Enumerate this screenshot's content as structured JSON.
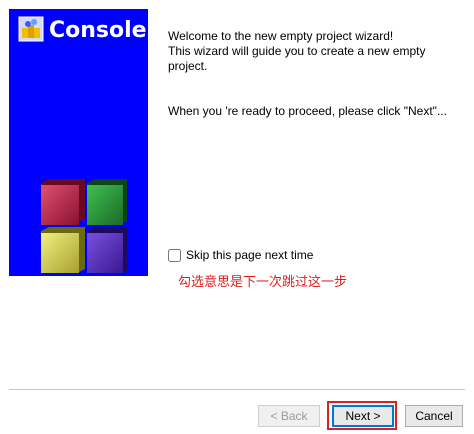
{
  "banner": {
    "title": "Console",
    "icon": "codeblocks-logo-icon",
    "background": "#0000ff"
  },
  "intro": {
    "line1": "Welcome to the new empty project wizard!\nThis wizard will guide you to create a new empty project.",
    "line2": "When you 're ready to proceed, please click \"Next\"..."
  },
  "skip_checkbox": {
    "label": "Skip this page next time",
    "checked": false
  },
  "annotation": {
    "text": "勾选意思是下一次跳过这一步",
    "color": "#e02020"
  },
  "buttons": {
    "back": "< Back",
    "next": "Next >",
    "cancel": "Cancel"
  }
}
